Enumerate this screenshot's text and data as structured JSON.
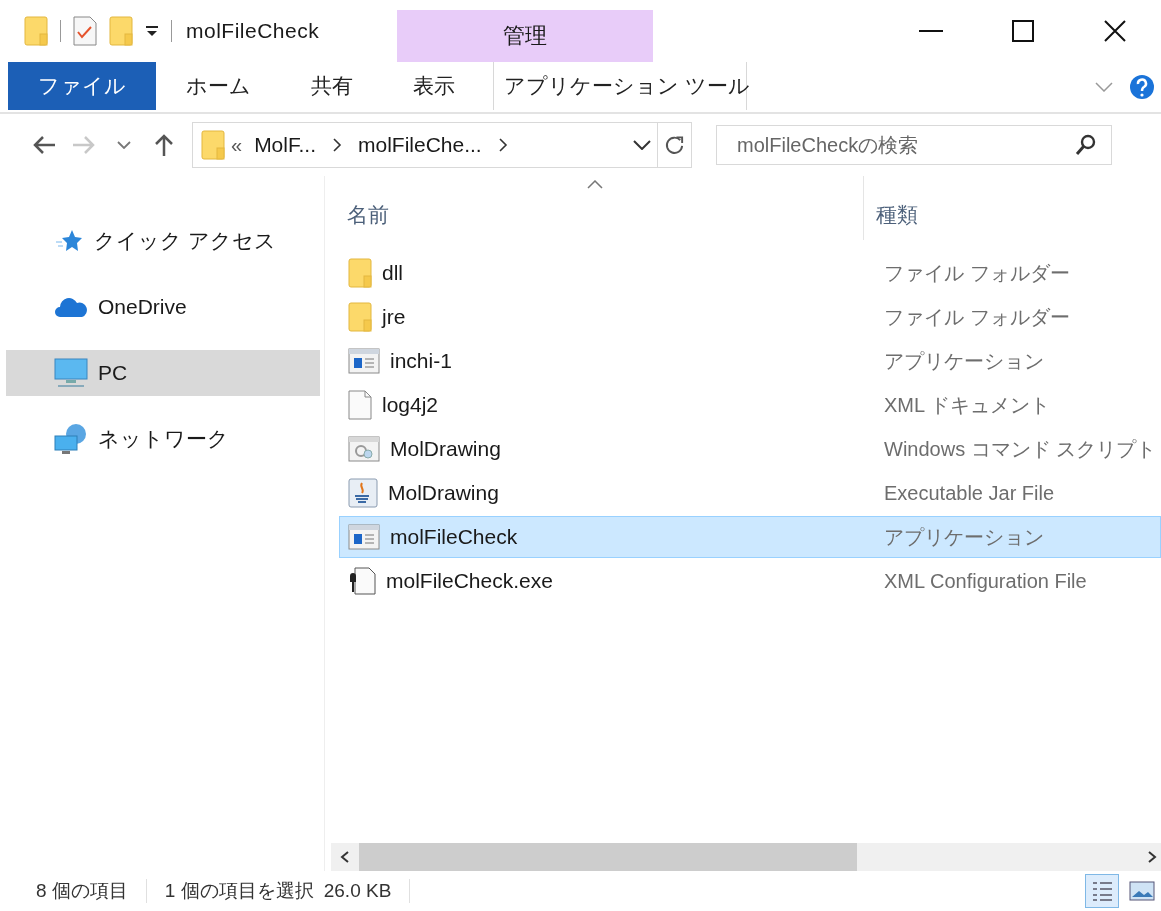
{
  "window": {
    "title": "molFileCheck"
  },
  "ribbon": {
    "context_header": "管理",
    "tabs": [
      {
        "label": "ファイル",
        "kind": "file",
        "selected": false
      },
      {
        "label": "ホーム",
        "kind": "plain",
        "selected": false
      },
      {
        "label": "共有",
        "kind": "plain",
        "selected": false
      },
      {
        "label": "表示",
        "kind": "plain",
        "selected": false
      },
      {
        "label": "アプリケーション ツール",
        "kind": "context",
        "selected": false
      }
    ]
  },
  "address": {
    "overflow": "«",
    "crumbs": [
      "MolF...",
      "molFileChe..."
    ]
  },
  "search": {
    "placeholder": "molFileCheckの検索"
  },
  "sidebar": {
    "items": [
      {
        "label": "クイック アクセス",
        "kind": "star",
        "selected": false
      },
      {
        "label": "OneDrive",
        "kind": "cloud",
        "selected": false
      },
      {
        "label": "PC",
        "kind": "monitor",
        "selected": true
      },
      {
        "label": "ネットワーク",
        "kind": "network",
        "selected": false
      }
    ]
  },
  "table": {
    "columns": [
      "名前",
      "種類"
    ],
    "rows": [
      {
        "name": "dll",
        "type": "ファイル フォルダー",
        "kind": "folder",
        "selected": false
      },
      {
        "name": "jre",
        "type": "ファイル フォルダー",
        "kind": "folder",
        "selected": false
      },
      {
        "name": "inchi-1",
        "type": "アプリケーション",
        "kind": "app",
        "selected": false
      },
      {
        "name": "log4j2",
        "type": "XML ドキュメント",
        "kind": "document",
        "selected": false
      },
      {
        "name": "MolDrawing",
        "type": "Windows コマンド スクリプト",
        "kind": "script",
        "selected": false
      },
      {
        "name": "MolDrawing",
        "type": "Executable Jar File",
        "kind": "jar",
        "selected": false
      },
      {
        "name": "molFileCheck",
        "type": "アプリケーション",
        "kind": "app",
        "selected": true
      },
      {
        "name": "molFileCheck.exe",
        "type": "XML Configuration File",
        "kind": "config",
        "selected": false
      }
    ]
  },
  "status_bar": {
    "count": "8 個の項目",
    "selection": "1 個の項目を選択",
    "size": "26.0 KB"
  }
}
